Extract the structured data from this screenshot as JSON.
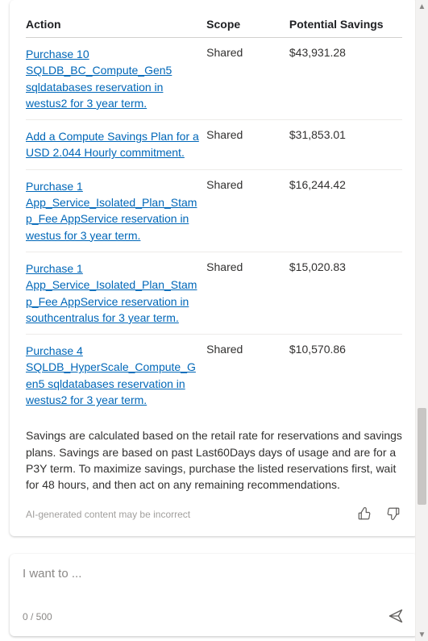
{
  "table": {
    "headers": {
      "action": "Action",
      "scope": "Scope",
      "savings": "Potential Savings"
    },
    "rows": [
      {
        "action": "Purchase 10 SQLDB_BC_Compute_Gen5 sqldatabases reservation in westus2 for 3 year term.",
        "scope": "Shared",
        "savings": "$43,931.28"
      },
      {
        "action": "Add a Compute Savings Plan for a USD 2.044 Hourly commitment.",
        "scope": "Shared",
        "savings": "$31,853.01"
      },
      {
        "action": "Purchase 1 App_Service_Isolated_Plan_Stamp_Fee AppService reservation in westus for 3 year term.",
        "scope": "Shared",
        "savings": "$16,244.42"
      },
      {
        "action": "Purchase 1 App_Service_Isolated_Plan_Stamp_Fee AppService reservation in southcentralus for 3 year term.",
        "scope": "Shared",
        "savings": "$15,020.83"
      },
      {
        "action": "Purchase 4 SQLDB_HyperScale_Compute_Gen5 sqldatabases reservation in westus2 for 3 year term.",
        "scope": "Shared",
        "savings": "$10,570.86"
      }
    ]
  },
  "disclaimer": "Savings are calculated based on the retail rate for reservations and savings plans. Savings are based on past Last60Days days of usage and are for a P3Y term. To maximize savings, purchase the listed reservations first, wait for 48 hours, and then act on any remaining recommendations.",
  "ai_note": "AI-generated content may be incorrect",
  "input": {
    "placeholder": "I want to ...",
    "char_count": "0 / 500"
  }
}
